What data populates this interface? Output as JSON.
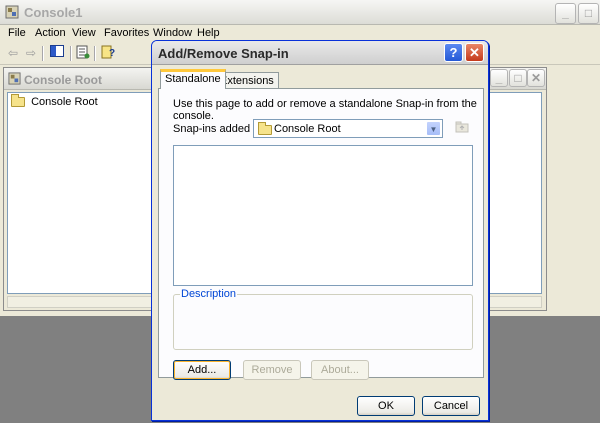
{
  "app": {
    "title": "Console1",
    "menu": [
      "File",
      "Action",
      "View",
      "Favorites",
      "Window",
      "Help"
    ]
  },
  "child_window": {
    "title": "Console Root",
    "tree_root": "Console Root"
  },
  "dialog": {
    "title": "Add/Remove Snap-in",
    "tabs": [
      "Standalone",
      "Extensions"
    ],
    "intro": "Use this page to add or remove a standalone Snap-in from the console.",
    "snapins_label": "Snap-ins added to:",
    "snapins_value": "Console Root",
    "description_label": "Description",
    "buttons": {
      "add": "Add...",
      "remove": "Remove",
      "about": "About...",
      "ok": "OK",
      "cancel": "Cancel"
    }
  },
  "icons": {
    "close": "close-icon",
    "help": "help-icon",
    "folder": "folder-icon"
  },
  "colors": {
    "dialog_border": "#0831d9",
    "close_button": "#c4391b",
    "help_button": "#2459d6",
    "tab_highlight": "#ffc83c"
  }
}
